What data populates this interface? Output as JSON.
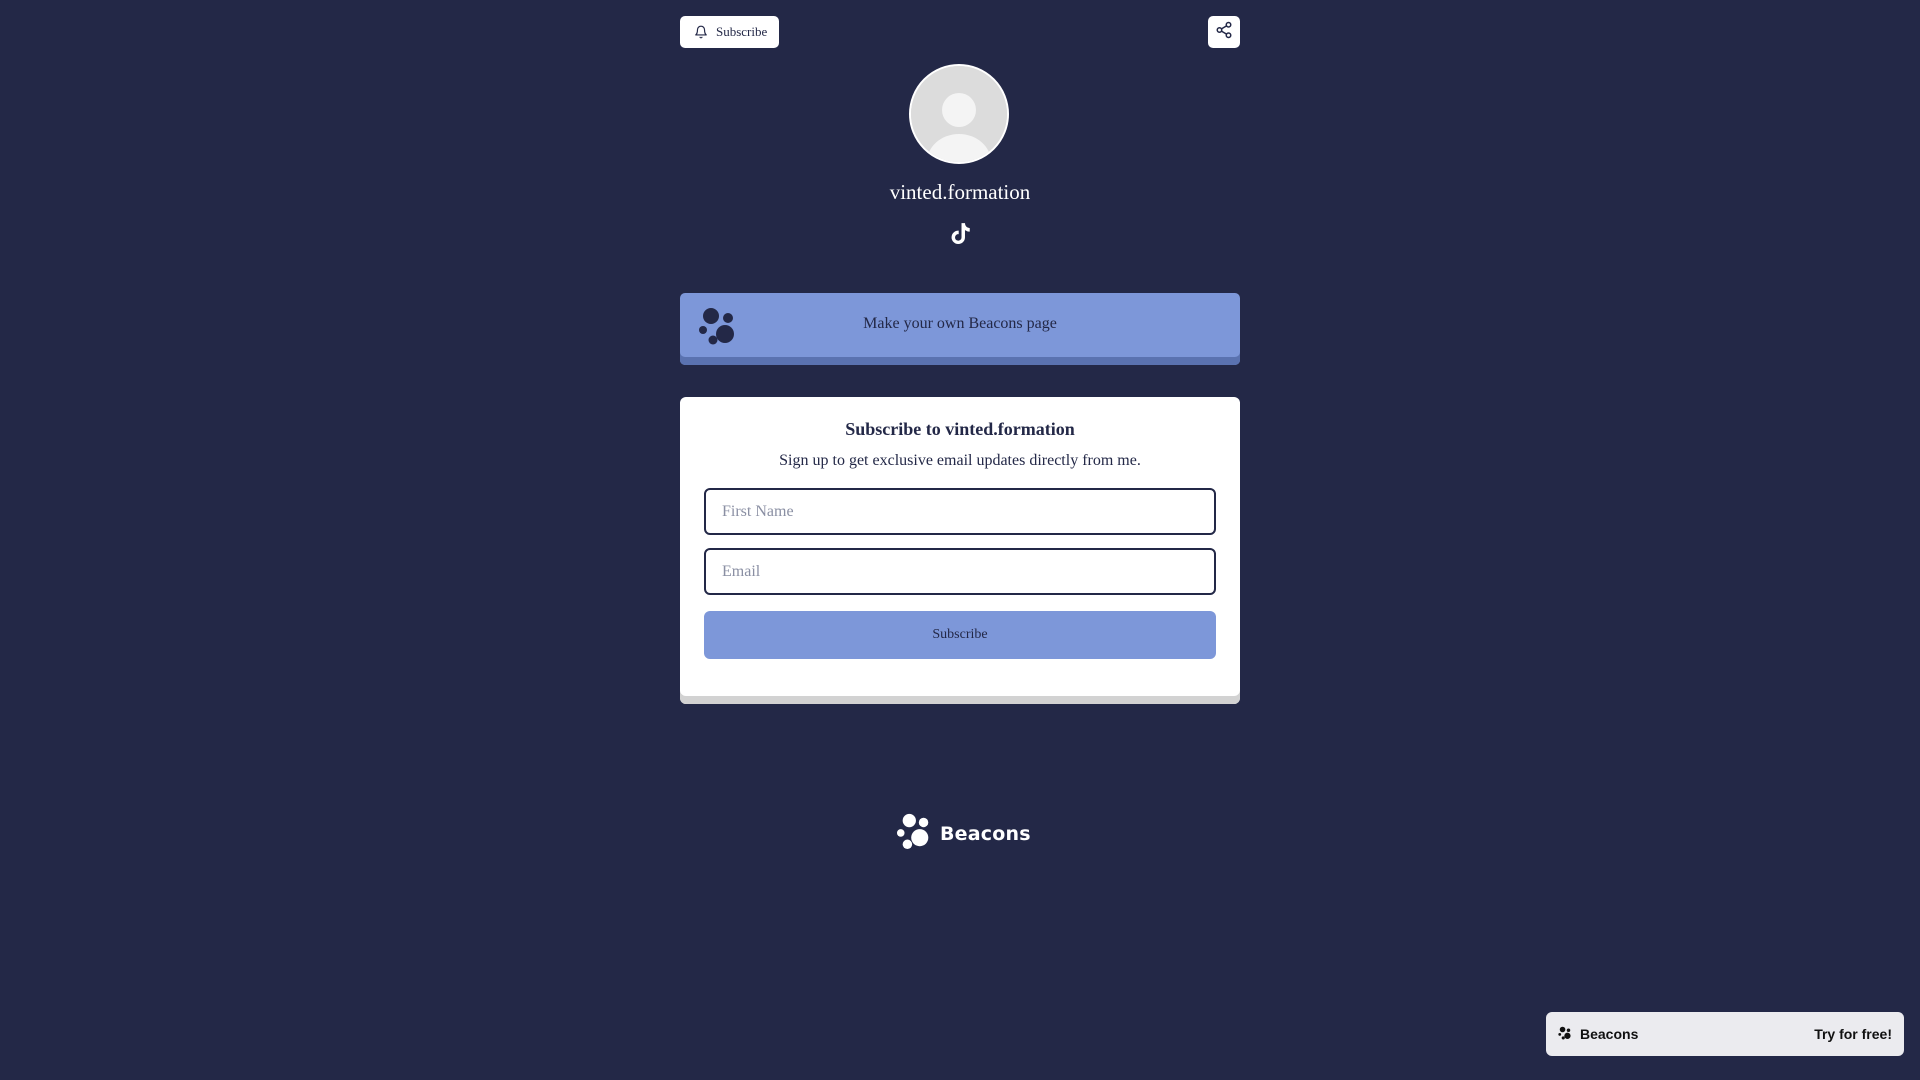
{
  "header": {
    "subscribe_label": "Subscribe"
  },
  "profile": {
    "username": "vinted.formation",
    "social_icons": [
      "tiktok-icon"
    ]
  },
  "beacons_cta": {
    "label": "Make your own Beacons page"
  },
  "subscribe_card": {
    "title": "Subscribe to vinted.formation",
    "description": "Sign up to get exclusive email updates directly from me.",
    "first_name_placeholder": "First Name",
    "first_name_value": "",
    "email_placeholder": "Email",
    "email_value": "",
    "button_label": "Subscribe"
  },
  "footer": {
    "brand": "Beacons"
  },
  "promo_bar": {
    "brand": "Beacons",
    "cta": "Try for free!"
  },
  "colors": {
    "background": "#232847",
    "accent": "#7d97d9",
    "card": "#ffffff"
  }
}
